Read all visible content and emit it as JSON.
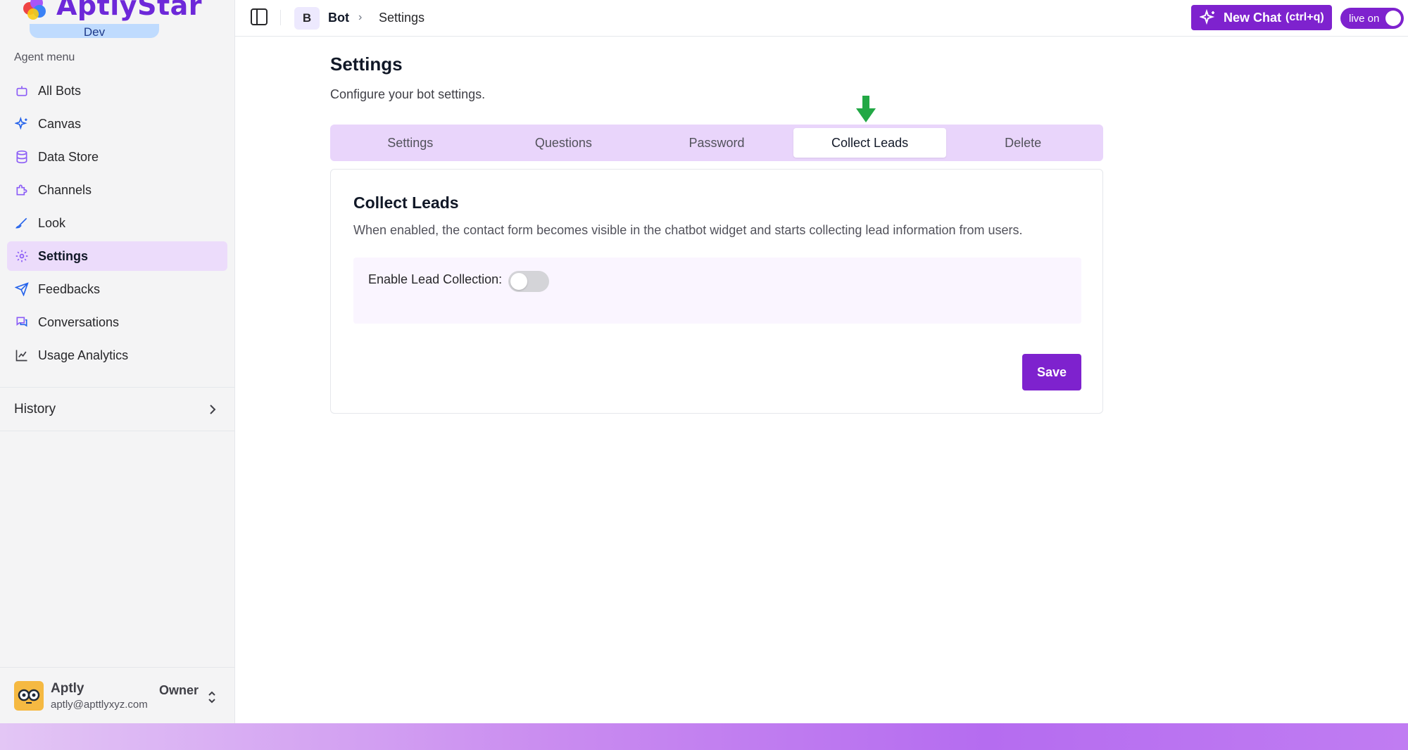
{
  "brand": {
    "name": "AptlyStar",
    "badge": "Dev"
  },
  "sidebar": {
    "heading": "Agent menu",
    "items": [
      {
        "label": "All Bots",
        "icon": "bot-icon"
      },
      {
        "label": "Canvas",
        "icon": "sparkles-icon"
      },
      {
        "label": "Data Store",
        "icon": "database-icon"
      },
      {
        "label": "Channels",
        "icon": "puzzle-icon"
      },
      {
        "label": "Look",
        "icon": "paintbrush-icon"
      },
      {
        "label": "Settings",
        "icon": "gear-icon",
        "active": true
      },
      {
        "label": "Feedbacks",
        "icon": "send-icon"
      },
      {
        "label": "Conversations",
        "icon": "chat-icon"
      },
      {
        "label": "Usage Analytics",
        "icon": "line-chart-icon"
      }
    ],
    "history_label": "History",
    "user": {
      "name": "Aptly",
      "email": "aptly@apttlyxyz.com",
      "role": "Owner"
    }
  },
  "topbar": {
    "crumb_badge": "B",
    "crumb_bot": "Bot",
    "crumb_page": "Settings",
    "new_chat_label": "New Chat",
    "new_chat_shortcut": "(ctrl+q)",
    "live_label": "live on"
  },
  "main": {
    "title": "Settings",
    "subtitle": "Configure your bot settings.",
    "tabs": [
      {
        "label": "Settings"
      },
      {
        "label": "Questions"
      },
      {
        "label": "Password"
      },
      {
        "label": "Collect Leads",
        "active": true
      },
      {
        "label": "Delete"
      }
    ],
    "card": {
      "title": "Collect Leads",
      "description": "When enabled, the contact form becomes visible in the chatbot widget and starts collecting lead information from users.",
      "toggle_label": "Enable Lead Collection",
      "toggle_enabled": false,
      "save_label": "Save"
    }
  },
  "colors": {
    "accent": "#7e22ce",
    "active_menu_bg": "#ecdcfb",
    "tabs_bg": "#e9d5fb",
    "marker_arrow": "#22a845"
  }
}
